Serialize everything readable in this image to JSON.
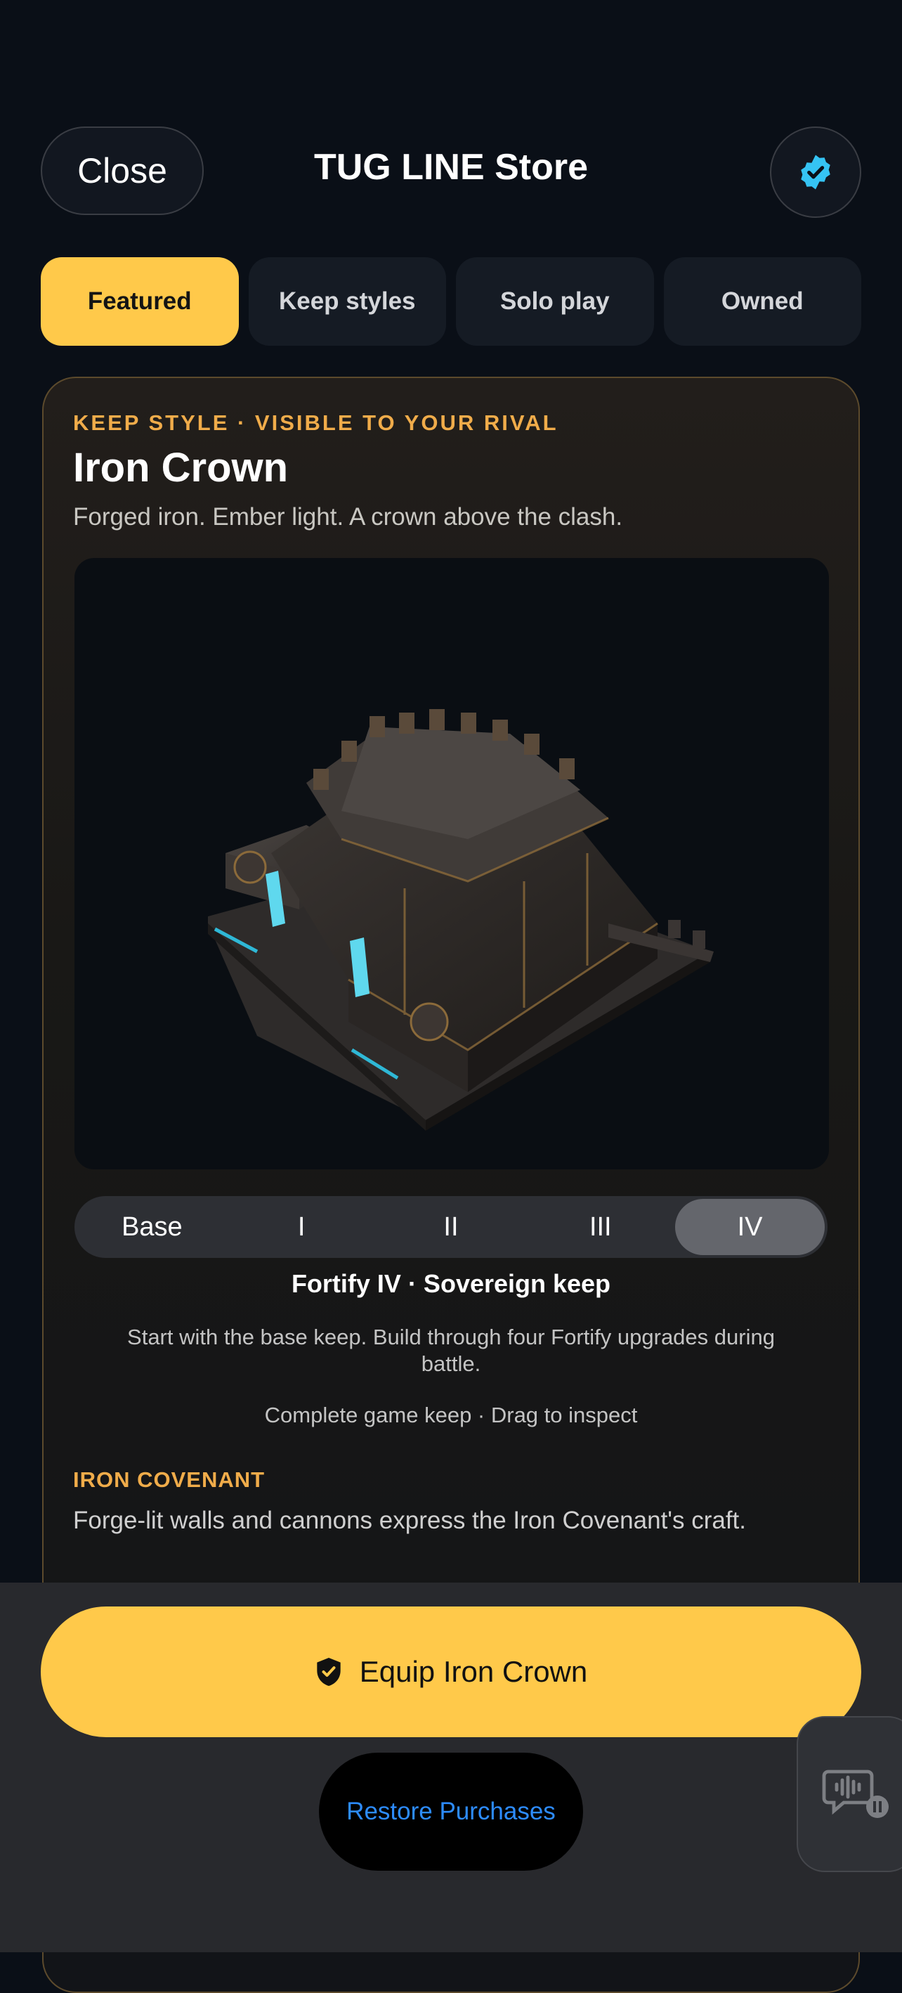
{
  "header": {
    "close_label": "Close",
    "title": "TUG LINE Store",
    "verified_icon": "verified-badge-icon"
  },
  "tabs": [
    {
      "label": "Featured",
      "active": true
    },
    {
      "label": "Keep styles",
      "active": false
    },
    {
      "label": "Solo play",
      "active": false
    },
    {
      "label": "Owned",
      "active": false
    }
  ],
  "featured_item": {
    "eyebrow": "KEEP STYLE · VISIBLE TO YOUR RIVAL",
    "title": "Iron Crown",
    "subtitle": "Forged iron. Ember light. A crown above the clash.",
    "preview_image": "3D castle keep model"
  },
  "tier_selector": {
    "options": [
      "Base",
      "I",
      "II",
      "III",
      "IV"
    ],
    "selected": "IV"
  },
  "tier_info": {
    "title": "Fortify IV · Sovereign keep",
    "description": "Start with the base keep. Build through four Fortify upgrades during battle.",
    "hint": "Complete game keep · Drag to inspect"
  },
  "faction": {
    "name": "IRON COVENANT",
    "description": "Forge-lit walls and cannons express the Iron Covenant's craft."
  },
  "actions": {
    "equip_label": "Equip Iron Crown",
    "equip_icon": "shield-check-icon",
    "restore_label": "Restore Purchases",
    "voice_icon": "voice-chat-paused-icon"
  },
  "colors": {
    "accent": "#ffc94a",
    "eyebrow": "#f0ac4a",
    "link": "#2d8cff",
    "verified": "#35c3f3",
    "background": "#0a0f17"
  }
}
